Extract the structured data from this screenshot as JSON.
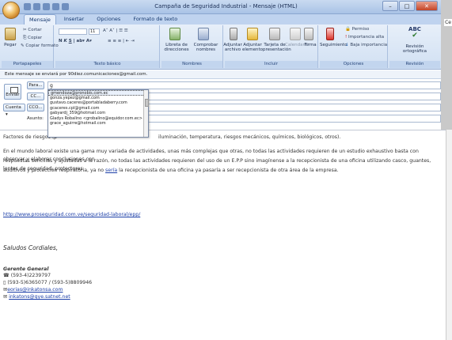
{
  "window": {
    "title": "Campaña de Seguridad Industrial - Mensaje (HTML)",
    "side_label": "Ce"
  },
  "tabs": [
    "Mensaje",
    "Insertar",
    "Opciones",
    "Formato de texto"
  ],
  "ribbon": {
    "portapapeles": {
      "label": "Portapapeles",
      "paste": "Pegar",
      "cut": "Cortar",
      "copy": "Copiar",
      "format": "Copiar formato"
    },
    "texto": {
      "label": "Texto básico",
      "font_size": "11"
    },
    "nombres": {
      "label": "Nombres",
      "book": "Libreta de direcciones",
      "check": "Comprobar nombres"
    },
    "incluir": {
      "label": "Incluir",
      "attach_file": "Adjuntar archivo",
      "attach_item": "Adjuntar elemento",
      "card": "Tarjeta de presentación",
      "calendar": "Calendario",
      "sign": "Firma"
    },
    "opciones": {
      "label": "Opciones",
      "follow": "Seguimiento",
      "perm": "Permiso",
      "high": "Importancia alta",
      "low": "Baja importancia"
    },
    "revision": {
      "label": "Revisión",
      "spell": "Revisión ortográfica",
      "abc": "ABC"
    }
  },
  "info_bar": "Este mensaje se enviará por 90diez.comunicaciones@gmail.com.",
  "header": {
    "send": "Enviar",
    "to_btn": "Para...",
    "cc_btn": "CC...",
    "cco_btn": "CCO...",
    "account": "Cuenta",
    "subject_label": "Asunto:",
    "to_value": "g",
    "cc_value": "",
    "cco_value": "",
    "subject_value": ""
  },
  "autocomplete": [
    "gmendoza@pronobis.com.ec",
    "gonza.yepez@gmail.com",
    "gustavo.caceres@portabladaberry.com",
    "gcaceres.cpl@gmail.com",
    "gabyardj_359@hotmail.com",
    "Gladys Robalino <grobalino@equidor.com.ec>",
    "grace_aguirre@hotmail.com"
  ],
  "body": {
    "p1_prefix": "Factores de riesgos (p",
    "p1": "Factores de riesgos (p... iluminación, temperatura, riesgos mecánicos, químicos, biológicos, otros).",
    "p1_suffix": "iluminación, temperatura, riesgos mecánicos, químicos, biológicos, otros).",
    "p2a": "En el mundo laboral existe una gama muy variada de actividades, unas más complejas que otras, no todas las actividades requieren de un estudio exhaustivo basta con observar y elaborar conclusiones con",
    "p2b": "respuestas sencillas y ajustadas a la razón, no todas las actividades requieren del uso de un E.P.P sino imagínense a la recepcionista de una oficina utilizando casco, guantes, lentes de seguridad, protectores",
    "p2c1": "auditivos y protección respiratoria, ya no ",
    "p2c_link": "sería",
    "p2c2": " la recepcionista de una oficina ya pasaría a ser recepcionista de otra área de la empresa.",
    "url": "http://www.proseguridad.com.ve/seguridad-laboral/epp/",
    "greeting": "Saludos Cordiales,",
    "sig_title": "Gerente General",
    "phone1": "(593-4)2239797",
    "phone2": "(593-5)6365077 / (593-5)8809946",
    "email1": "eorias@inkatonsa.com",
    "email2": "inkatons@gye.satnet.net"
  }
}
